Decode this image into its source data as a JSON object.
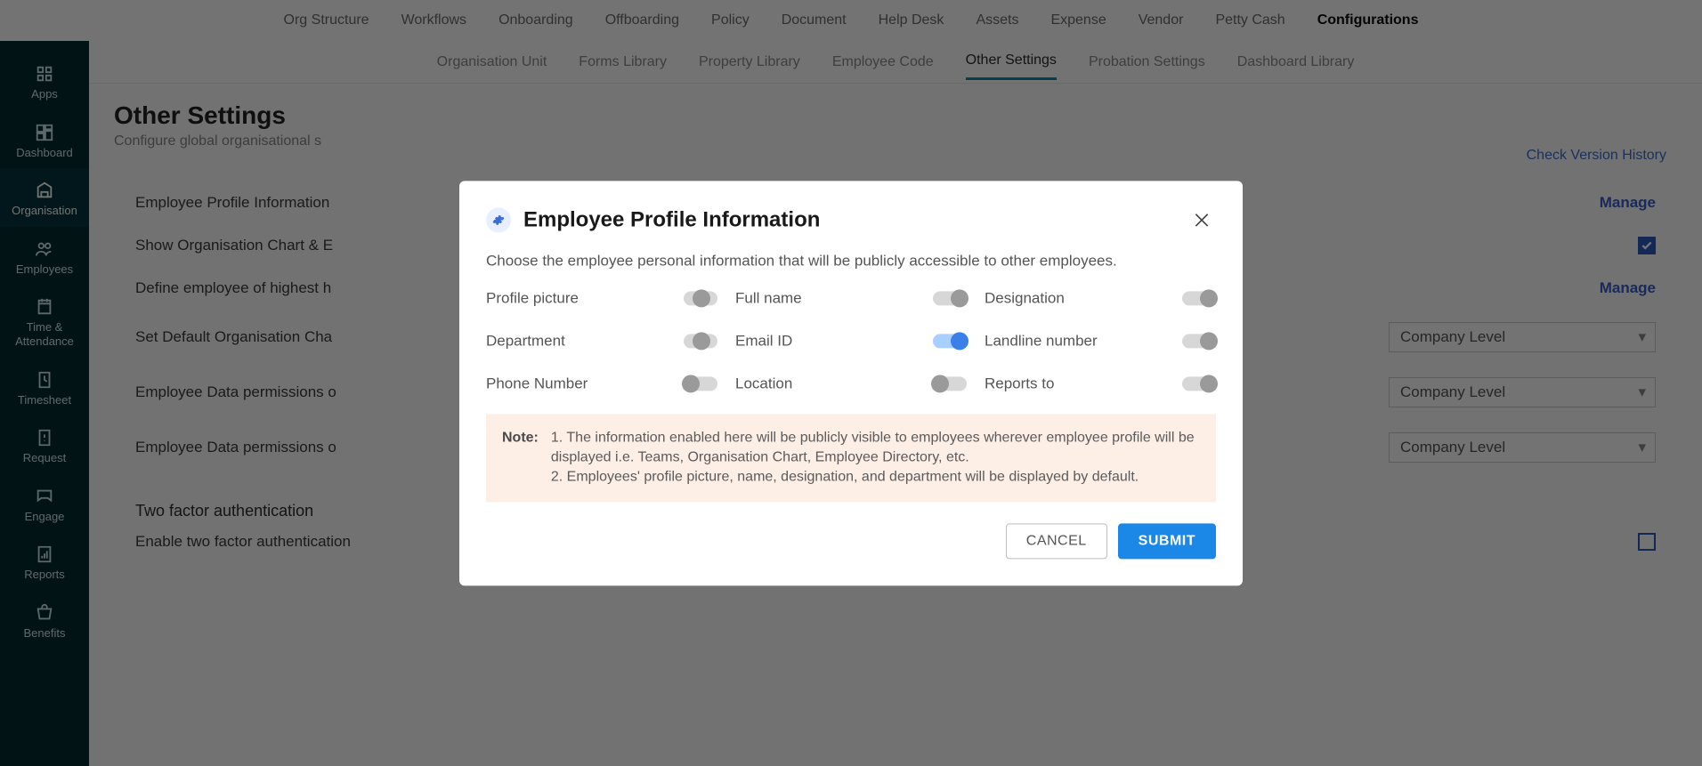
{
  "top_nav": {
    "items": [
      {
        "label": "Org Structure"
      },
      {
        "label": "Workflows"
      },
      {
        "label": "Onboarding"
      },
      {
        "label": "Offboarding"
      },
      {
        "label": "Policy"
      },
      {
        "label": "Document"
      },
      {
        "label": "Help Desk"
      },
      {
        "label": "Assets"
      },
      {
        "label": "Expense"
      },
      {
        "label": "Vendor"
      },
      {
        "label": "Petty Cash"
      },
      {
        "label": "Configurations",
        "active": true
      }
    ]
  },
  "sidebar": {
    "items": [
      {
        "key": "apps",
        "label": "Apps"
      },
      {
        "key": "dashboard",
        "label": "Dashboard"
      },
      {
        "key": "organisation",
        "label": "Organisation",
        "active": true
      },
      {
        "key": "employees",
        "label": "Employees"
      },
      {
        "key": "time-attendance",
        "label": "Time & Attendance"
      },
      {
        "key": "timesheet",
        "label": "Timesheet"
      },
      {
        "key": "request",
        "label": "Request"
      },
      {
        "key": "engage",
        "label": "Engage"
      },
      {
        "key": "reports",
        "label": "Reports"
      },
      {
        "key": "benefits",
        "label": "Benefits"
      }
    ]
  },
  "sub_nav": {
    "items": [
      {
        "label": "Organisation Unit"
      },
      {
        "label": "Forms Library"
      },
      {
        "label": "Property Library"
      },
      {
        "label": "Employee Code"
      },
      {
        "label": "Other Settings",
        "active": true
      },
      {
        "label": "Probation Settings"
      },
      {
        "label": "Dashboard Library"
      }
    ]
  },
  "page": {
    "title": "Other Settings",
    "subtitle": "Configure global organisational s",
    "version_link": "Check Version History"
  },
  "settings": {
    "rows": [
      {
        "label": "Employee Profile Information",
        "action": "Manage"
      },
      {
        "label": "Show Organisation Chart & E",
        "action_type": "checkbox",
        "checked": true
      },
      {
        "label": "Define employee of highest h",
        "action": "Manage"
      },
      {
        "label": "Set Default Organisation Cha",
        "dropdown": "Company Level"
      },
      {
        "label": "Employee Data permissions o",
        "dropdown": "Company Level"
      },
      {
        "label": "Employee Data permissions o",
        "dropdown": "Company Level"
      }
    ],
    "section2_title": "Two factor authentication",
    "section2_row": "Enable two factor authentication"
  },
  "modal": {
    "title": "Employee Profile Information",
    "description": "Choose the employee personal information that will be publicly accessible to other employees.",
    "toggles": [
      {
        "label": "Profile picture",
        "state": "off-mid"
      },
      {
        "label": "Full name",
        "state": "off-right"
      },
      {
        "label": "Designation",
        "state": "off-right"
      },
      {
        "label": "Department",
        "state": "off-mid"
      },
      {
        "label": "Email ID",
        "state": "on"
      },
      {
        "label": "Landline number",
        "state": "off-right"
      },
      {
        "label": "Phone Number",
        "state": "off-left"
      },
      {
        "label": "Location",
        "state": "off-left"
      },
      {
        "label": "Reports to",
        "state": "off-right"
      }
    ],
    "note_label": "Note:",
    "note_line1": "1. The information enabled here will be publicly visible to employees wherever employee profile will be displayed i.e. Teams, Organisation Chart, Employee Directory, etc.",
    "note_line2": "2. Employees' profile picture, name, designation, and department will be displayed by default.",
    "cancel_label": "CANCEL",
    "submit_label": "SUBMIT"
  }
}
